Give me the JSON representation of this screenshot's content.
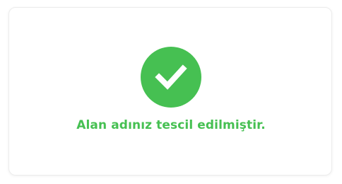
{
  "status": {
    "icon": "check-circle-icon",
    "message": "Alan adınız tescil edilmiştir."
  },
  "colors": {
    "success": "#46c052",
    "icon_mark": "#ffffff",
    "card_border": "#ececec",
    "background": "#ffffff"
  }
}
